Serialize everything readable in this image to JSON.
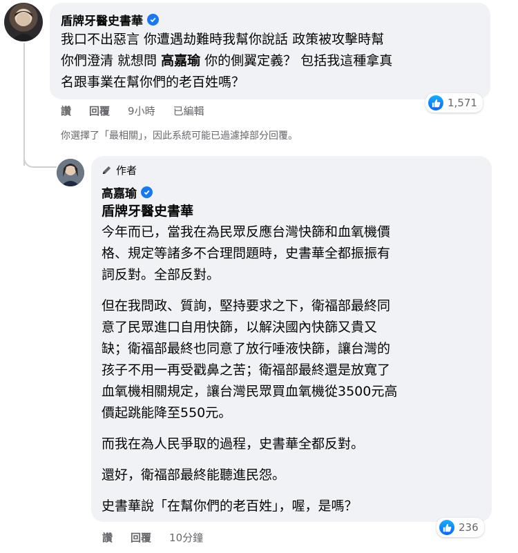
{
  "comment1": {
    "author": "盾牌牙醫史書華",
    "lines": [
      "我口不出惡言 你遭遇劫難時我幫你說話 政策被攻擊時幫",
      "你們澄清 就想問 ",
      "名跟事業在幫你們的老百姓嗎？"
    ],
    "mention": "高嘉瑜",
    "line2_tail": " 你的側翼定義？ 包括我這種拿真",
    "actions": {
      "like": "讚",
      "reply": "回覆",
      "time": "9小時",
      "edited": "已編輯"
    },
    "reaction_count": "1,571"
  },
  "filter_note": "你選擇了「最相關」，因此系統可能已過濾掉部分回覆。",
  "reply": {
    "badge": "作者",
    "author": "高嘉瑜",
    "mention": "盾牌牙醫史書華",
    "paragraphs": [
      [
        "今年而已，當我在為民眾反應台灣快篩和血氧機價",
        "格、規定等諸多不合理問題時，史書華全都振振有",
        "詞反對。全部反對。"
      ],
      [
        "但在我問政、質詢，堅持要求之下，衛福部最終同",
        "意了民眾進口自用快篩，以解決國內快篩又貴又",
        "缺；衛福部最終也同意了放行唾液快篩，讓台灣的",
        "孩子不用一再受戳鼻之苦；衛福部最終還是放寬了",
        "血氧機相關規定，讓台灣民眾買血氧機從3500元高",
        "價起跳能降至550元。"
      ],
      [
        "而我在為人民爭取的過程，史書華全都反對。"
      ],
      [
        "還好，衛福部最終能聽進民怨。"
      ],
      [
        "史書華說「在幫你們的老百姓」，喔，是嗎？"
      ]
    ],
    "actions": {
      "like": "讚",
      "reply": "回覆",
      "time": "10分鐘"
    },
    "reaction_count": "236"
  },
  "icons": {
    "verified": "verified-badge-icon",
    "pencil": "pencil-icon",
    "like": "like-thumb-icon"
  },
  "colors": {
    "accent": "#1877f2",
    "bubble": "#f0f2f5",
    "meta": "#65676b"
  }
}
